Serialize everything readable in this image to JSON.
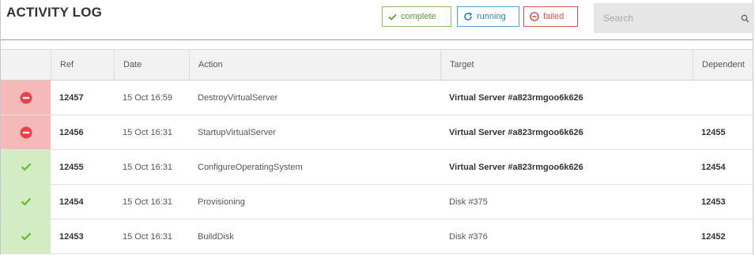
{
  "header": {
    "title": "ACTIVITY LOG",
    "filters": [
      {
        "label": "complete",
        "icon": "check-icon",
        "color": "#5a9d2e"
      },
      {
        "label": "running",
        "icon": "refresh-icon",
        "color": "#2a85c8"
      },
      {
        "label": "failed",
        "icon": "minus-circle-icon",
        "color": "#d9534f"
      }
    ],
    "search": {
      "placeholder": "Search",
      "value": ""
    }
  },
  "table": {
    "columns": [
      "",
      "Ref",
      "Date",
      "Action",
      "Target",
      "Dependent"
    ],
    "rows": [
      {
        "status": "failed",
        "ref": "12457",
        "date": "15 Oct 16:59",
        "action": "DestroyVirtualServer",
        "target": "Virtual Server #a823rmgoo6k626",
        "dependent": ""
      },
      {
        "status": "failed",
        "ref": "12456",
        "date": "15 Oct 16:31",
        "action": "StartupVirtualServer",
        "target": "Virtual Server #a823rmgoo6k626",
        "dependent": "12455"
      },
      {
        "status": "complete",
        "ref": "12455",
        "date": "15 Oct 16:31",
        "action": "ConfigureOperatingSystem",
        "target": "Virtual Server #a823rmgoo6k626",
        "dependent": "12454"
      },
      {
        "status": "complete",
        "ref": "12454",
        "date": "15 Oct 16:31",
        "action": "Provisioning",
        "target": "Disk #375",
        "dependent": "12453"
      },
      {
        "status": "complete",
        "ref": "12453",
        "date": "15 Oct 16:31",
        "action": "BuildDisk",
        "target": "Disk #376",
        "dependent": "12452"
      }
    ]
  },
  "colors": {
    "failed_bg": "#f5b9b9",
    "failed_icon": "#e8424a",
    "complete_bg": "#d4ecc4",
    "complete_icon": "#6cbf3c"
  }
}
